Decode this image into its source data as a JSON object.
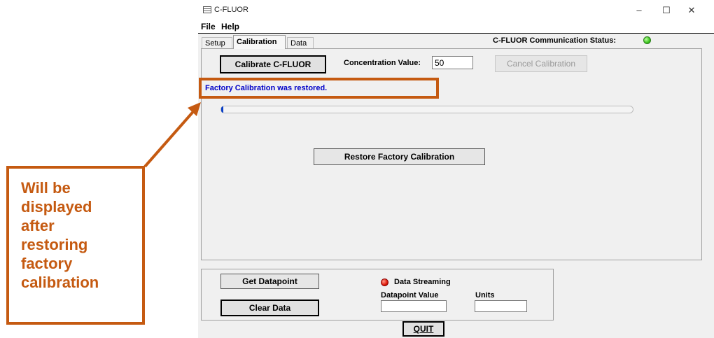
{
  "window": {
    "title": "C-FLUOR",
    "minimize_glyph": "–",
    "maximize_glyph": "☐",
    "close_glyph": "✕"
  },
  "menu": {
    "file": "File",
    "help": "Help"
  },
  "tabs": {
    "setup": "Setup",
    "calibration": "Calibration",
    "data": "Data",
    "active": "Calibration"
  },
  "status": {
    "label": "C-FLUOR Communication Status:",
    "indicator_color": "#3cc41e"
  },
  "calibration": {
    "calibrate_button": "Calibrate C-FLUOR",
    "concentration_label": "Concentration Value:",
    "concentration_value": "50",
    "cancel_button": "Cancel Calibration",
    "message": "Factory Calibration was restored.",
    "progress_fraction": 0.005,
    "restore_button": "Restore Factory Calibration"
  },
  "data_panel": {
    "get_datapoint_button": "Get Datapoint",
    "clear_data_button": "Clear Data",
    "streaming_label": "Data Streaming",
    "streaming_indicator_color": "#e01a0a",
    "datapoint_label": "Datapoint Value",
    "datapoint_value": "",
    "units_label": "Units",
    "units_value": "",
    "quit_button": "QUIT"
  },
  "annotation": {
    "callout_lines": [
      "Will be",
      "displayed",
      "after",
      "restoring",
      "factory",
      "calibration"
    ],
    "color": "#c55a11"
  }
}
